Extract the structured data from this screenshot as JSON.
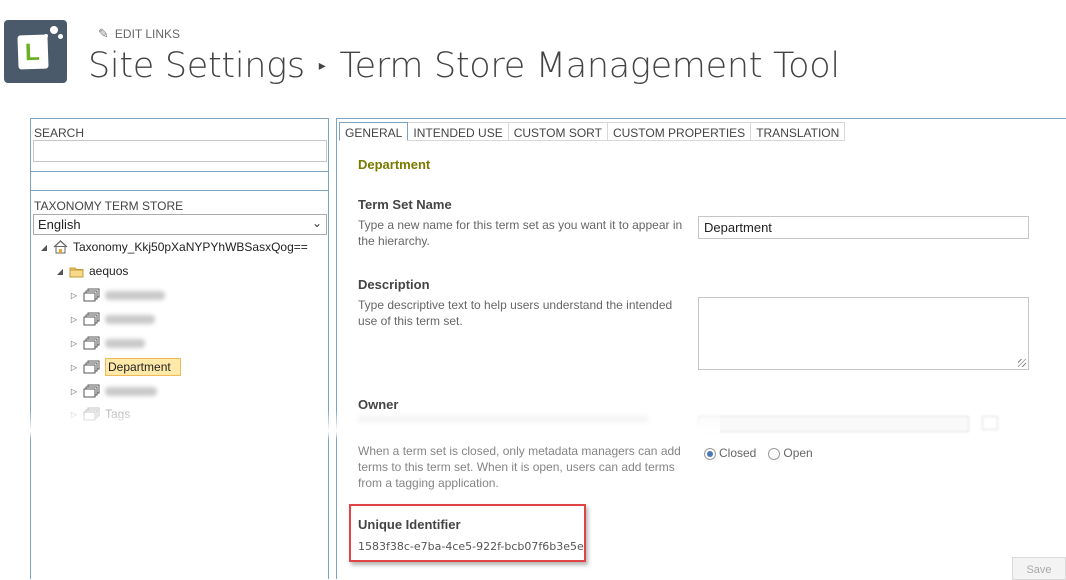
{
  "header": {
    "edit_links": "EDIT LINKS",
    "breadcrumb_site": "Site Settings",
    "breadcrumb_page": "Term Store Management Tool",
    "separator": "▸"
  },
  "left": {
    "search_label": "SEARCH",
    "search_value": "",
    "store_label": "TAXONOMY TERM STORE",
    "language": "English",
    "tree": {
      "root_label": "Taxonomy_Kkj50pXaNYPYhWBSasxQog==",
      "group_label": "aequos",
      "selected_label": "Department",
      "last_label": "Tags"
    }
  },
  "tabs": [
    "GENERAL",
    "INTENDED USE",
    "CUSTOM SORT",
    "CUSTOM PROPERTIES",
    "TRANSLATION"
  ],
  "general": {
    "heading": "Department",
    "term_set_name": {
      "label": "Term Set Name",
      "help": "Type a new name for this term set as you want it to appear in the hierarchy.",
      "value": "Department"
    },
    "description": {
      "label": "Description",
      "help": "Type descriptive text to help users understand the intended use of this term set.",
      "value": ""
    },
    "owner": {
      "label": "Owner"
    },
    "submission": {
      "help": "When a term set is closed, only metadata managers can add terms to this term set. When it is open, users can add terms from a tagging application.",
      "closed_label": "Closed",
      "open_label": "Open",
      "selected": "Closed"
    },
    "unique_identifier": {
      "label": "Unique Identifier",
      "value": "1583f38c-e7ba-4ce5-922f-bcb07f6b3e5e"
    },
    "save_label": "Save"
  },
  "colors": {
    "accent_border": "#7aa3c6",
    "highlight_red": "#e04444",
    "selected_bg": "#ffe9a8",
    "heading_olive": "#7a7a00"
  }
}
